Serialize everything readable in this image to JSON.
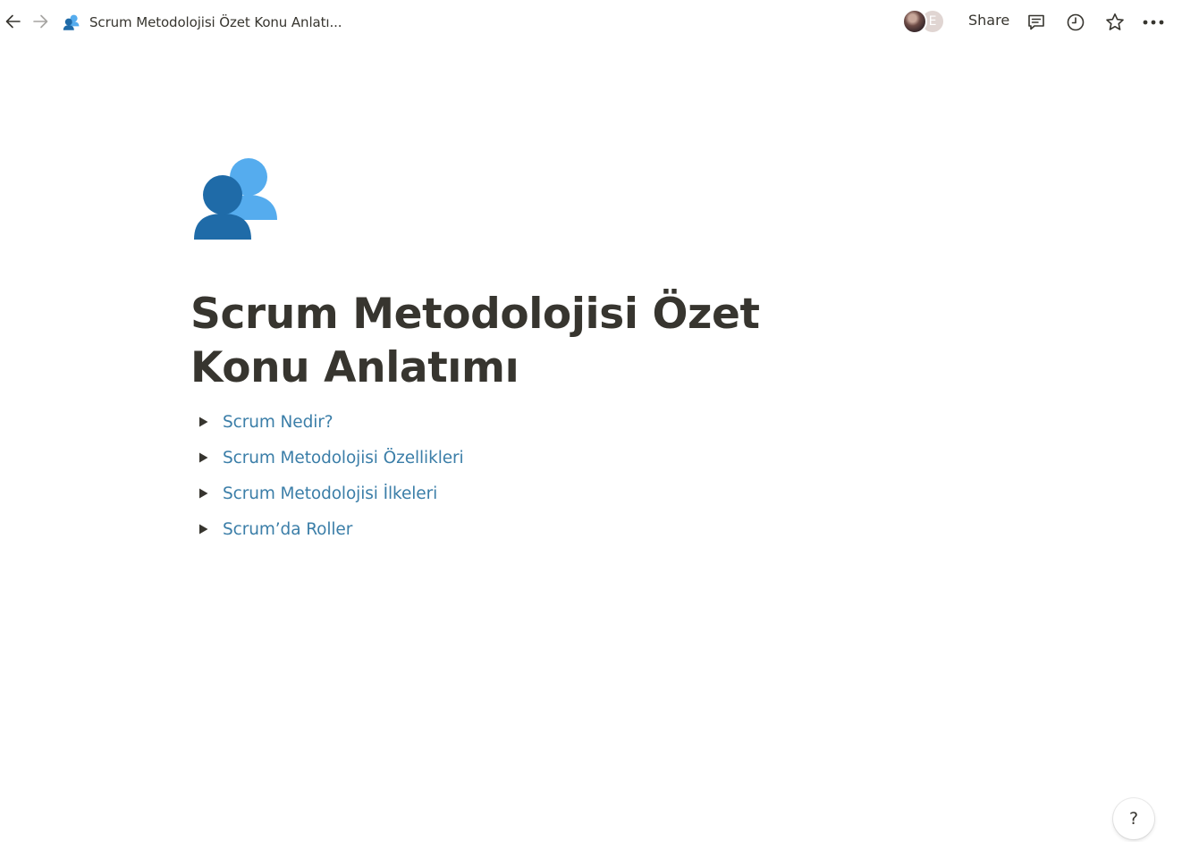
{
  "topbar": {
    "breadcrumb_title": "Scrum Metodolojisi Özet Konu Anlatı...",
    "avatar_letter": "E",
    "share_label": "Share",
    "icons": {
      "back": "arrow-left-icon",
      "forward": "arrow-right-icon",
      "comment": "comment-icon",
      "history": "clock-icon",
      "favorite": "star-icon",
      "more": "more-horizontal-icon"
    }
  },
  "page": {
    "icon": "busts-in-silhouette-emoji",
    "title": "Scrum Metodolojisi Özet Konu Anlatımı",
    "toggles": [
      {
        "label": "Scrum Nedir?"
      },
      {
        "label": "Scrum Metodolojisi Özellikleri"
      },
      {
        "label": "Scrum Metodolojisi İlkeleri"
      },
      {
        "label": "Scrum’da Roller"
      }
    ]
  },
  "help": {
    "label": "?"
  },
  "colors": {
    "text": "#37352f",
    "link": "#3b7ea8",
    "icon_dark_blue": "#1f6ba8",
    "icon_light_blue": "#55acee"
  }
}
